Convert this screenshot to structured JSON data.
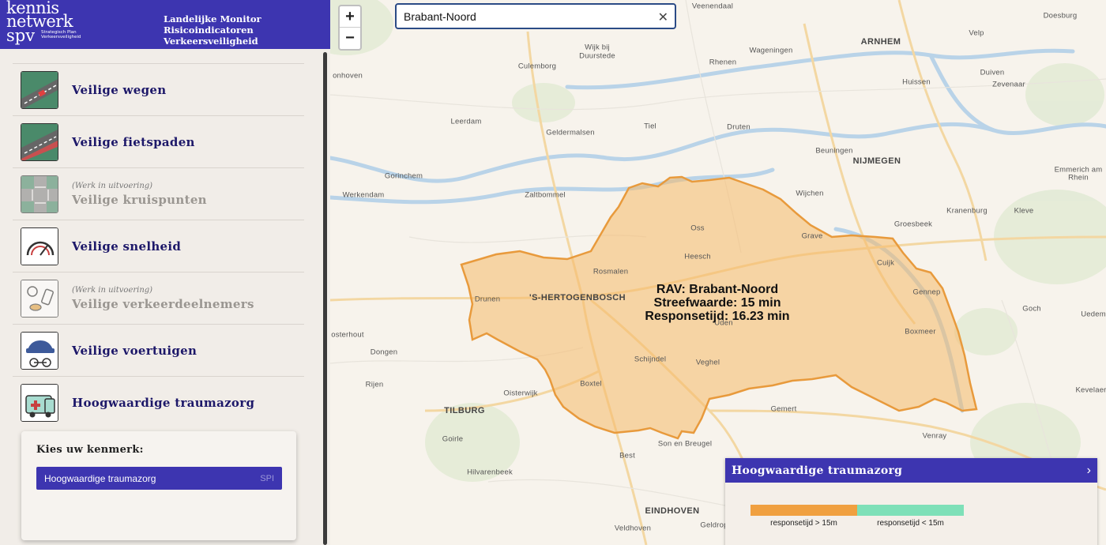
{
  "header": {
    "logo": {
      "line1": "kennis",
      "line2": "netwerk",
      "line3": "spv",
      "tagline": "Strategisch Plan Verkeersveiligheid"
    },
    "title_line1": "Landelijke Monitor",
    "title_line2": "Risicoindicatoren Verkeersveiligheid"
  },
  "menu": {
    "items": [
      {
        "label": "Veilige wegen",
        "icon": "road-icon"
      },
      {
        "label": "Veilige fietspaden",
        "icon": "bike-path-icon"
      },
      {
        "label": "Veilige kruispunten",
        "icon": "intersection-icon",
        "note": "(Werk in uitvoering)"
      },
      {
        "label": "Veilige snelheid",
        "icon": "speedometer-icon"
      },
      {
        "label": "Veilige verkeerdeelnemers",
        "icon": "road-users-icon",
        "note": "(Werk in uitvoering)"
      },
      {
        "label": "Veilige voertuigen",
        "icon": "vehicles-icon"
      },
      {
        "label": "Hoogwaardige traumazorg",
        "icon": "ambulance-icon"
      }
    ]
  },
  "kenmerk": {
    "title": "Kies uw kenmerk:",
    "selected": "Hoogwaardige traumazorg",
    "badge": "SPI"
  },
  "search": {
    "value": "Brabant-Noord"
  },
  "zoom": {
    "in": "+",
    "out": "−"
  },
  "region": {
    "line1": "RAV: Brabant-Noord",
    "line2": "Streefwaarde: 15 min",
    "line3": "Responsetijd: 16.23 min",
    "fill_color": "#f5b96a",
    "border_color": "#e89a3c"
  },
  "places": [
    {
      "name": "Veenendaal",
      "city": false
    },
    {
      "name": "Doesburg",
      "city": false
    },
    {
      "name": "ARNHEM",
      "city": true
    },
    {
      "name": "Velp",
      "city": false
    },
    {
      "name": "Wijk bij",
      "city": false
    },
    {
      "name": "Duurstede",
      "city": false
    },
    {
      "name": "Wageningen",
      "city": false
    },
    {
      "name": "Culemborg",
      "city": false
    },
    {
      "name": "Rhenen",
      "city": false
    },
    {
      "name": "Duiven",
      "city": false
    },
    {
      "name": "onhoven",
      "city": false
    },
    {
      "name": "Huissen",
      "city": false
    },
    {
      "name": "Zevenaar",
      "city": false
    },
    {
      "name": "Leerdam",
      "city": false
    },
    {
      "name": "Tiel",
      "city": false
    },
    {
      "name": "Druten",
      "city": false
    },
    {
      "name": "Geldermalsen",
      "city": false
    },
    {
      "name": "Beuningen",
      "city": false
    },
    {
      "name": "NIJMEGEN",
      "city": true
    },
    {
      "name": "Gorinchem",
      "city": false
    },
    {
      "name": "Emmerich am",
      "city": false
    },
    {
      "name": "Rhein",
      "city": false
    },
    {
      "name": "Werkendam",
      "city": false
    },
    {
      "name": "Zaltbommel",
      "city": false
    },
    {
      "name": "Wijchen",
      "city": false
    },
    {
      "name": "Kranenburg",
      "city": false
    },
    {
      "name": "Kleve",
      "city": false
    },
    {
      "name": "Oss",
      "city": false
    },
    {
      "name": "Groesbeek",
      "city": false
    },
    {
      "name": "Grave",
      "city": false
    },
    {
      "name": "Heesch",
      "city": false
    },
    {
      "name": "Cuijk",
      "city": false
    },
    {
      "name": "Rosmalen",
      "city": false
    },
    {
      "name": "Drunen",
      "city": false
    },
    {
      "name": "'S-HERTOGENBOSCH",
      "city": true
    },
    {
      "name": "Gennep",
      "city": false
    },
    {
      "name": "Uden",
      "city": false
    },
    {
      "name": "Goch",
      "city": false
    },
    {
      "name": "Uedem",
      "city": false
    },
    {
      "name": "osterhout",
      "city": false
    },
    {
      "name": "Boxmeer",
      "city": false
    },
    {
      "name": "Dongen",
      "city": false
    },
    {
      "name": "Schijndel",
      "city": false
    },
    {
      "name": "Veghel",
      "city": false
    },
    {
      "name": "Rijen",
      "city": false
    },
    {
      "name": "Boxtel",
      "city": false
    },
    {
      "name": "Oisterwijk",
      "city": false
    },
    {
      "name": "Kevelaer",
      "city": false
    },
    {
      "name": "TILBURG",
      "city": true
    },
    {
      "name": "Gemert",
      "city": false
    },
    {
      "name": "Goirle",
      "city": false
    },
    {
      "name": "Son en Breugel",
      "city": false
    },
    {
      "name": "Venray",
      "city": false
    },
    {
      "name": "Best",
      "city": false
    },
    {
      "name": "Hilvarenbeek",
      "city": false
    },
    {
      "name": "EINDHOVEN",
      "city": true
    },
    {
      "name": "Veldhoven",
      "city": false
    },
    {
      "name": "Geldrop",
      "city": false
    }
  ],
  "legend": {
    "title": "Hoogwaardige traumazorg",
    "items": [
      {
        "label": "responsetijd > 15m",
        "color": "#f0a040"
      },
      {
        "label": "responsetijd < 15m",
        "color": "#7ee0b8"
      }
    ]
  }
}
